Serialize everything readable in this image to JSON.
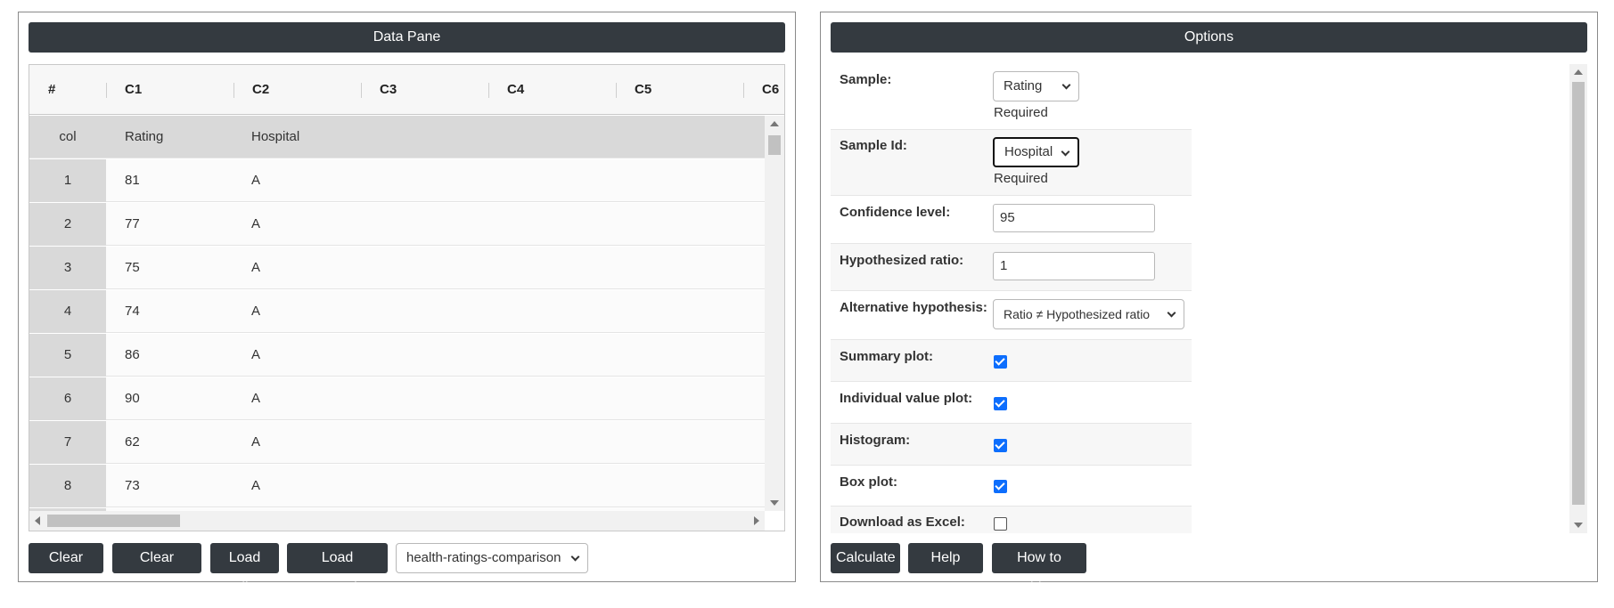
{
  "data_pane": {
    "title": "Data Pane",
    "columns": [
      "#",
      "C1",
      "C2",
      "C3",
      "C4",
      "C5",
      "C6"
    ],
    "col_row": {
      "label": "col",
      "c1": "Rating",
      "c2": "Hospital"
    },
    "rows": [
      {
        "num": "1",
        "c1": "81",
        "c2": "A"
      },
      {
        "num": "2",
        "c1": "77",
        "c2": "A"
      },
      {
        "num": "3",
        "c1": "75",
        "c2": "A"
      },
      {
        "num": "4",
        "c1": "74",
        "c2": "A"
      },
      {
        "num": "5",
        "c1": "86",
        "c2": "A"
      },
      {
        "num": "6",
        "c1": "90",
        "c2": "A"
      },
      {
        "num": "7",
        "c1": "62",
        "c2": "A"
      },
      {
        "num": "8",
        "c1": "73",
        "c2": "A"
      }
    ],
    "buttons": {
      "clear_data": "Clear Data",
      "clear_output": "Clear Output",
      "load_file": "Load File",
      "load_example": "Load Example"
    },
    "example_select": "health-ratings-comparison"
  },
  "options": {
    "title": "Options",
    "sample": {
      "label": "Sample:",
      "value": "Rating",
      "note": "Required"
    },
    "sample_id": {
      "label": "Sample Id:",
      "value": "Hospital",
      "note": "Required"
    },
    "confidence": {
      "label": "Confidence level:",
      "value": "95"
    },
    "hypothesized_ratio": {
      "label": "Hypothesized ratio:",
      "value": "1"
    },
    "alternative": {
      "label": "Alternative hypothesis:",
      "value": "Ratio ≠ Hypothesized ratio"
    },
    "summary_plot": {
      "label": "Summary plot:",
      "checked": true
    },
    "individual_value_plot": {
      "label": "Individual value plot:",
      "checked": true
    },
    "histogram": {
      "label": "Histogram:",
      "checked": true
    },
    "box_plot": {
      "label": "Box plot:",
      "checked": true
    },
    "download_excel": {
      "label": "Download as Excel:",
      "checked": false
    },
    "buttons": {
      "calculate": "Calculate",
      "help_page": "Help Page",
      "how_to_video": "How to Video"
    }
  },
  "colors": {
    "header_bg": "#343a40",
    "checkbox_blue": "#0d6efd",
    "row_number_bg": "#d9d9d9"
  }
}
